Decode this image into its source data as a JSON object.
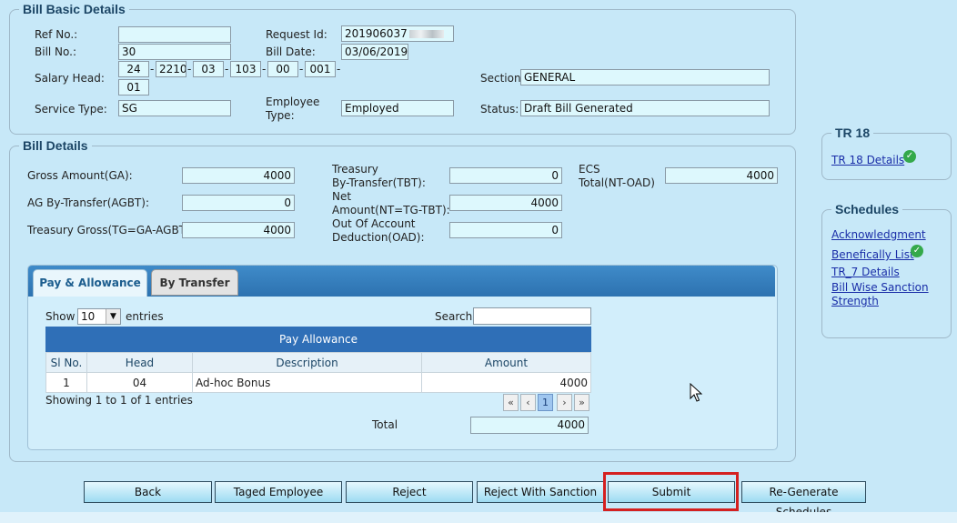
{
  "bill_basic": {
    "legend": "Bill Basic Details",
    "ref_label": "Ref No.:",
    "ref_value": "",
    "request_id_label": "Request Id:",
    "request_id_value": "201906037",
    "bill_no_label": "Bill No.:",
    "bill_no_value": "30",
    "bill_date_label": "Bill Date:",
    "bill_date_value": "03/06/2019",
    "salary_head_label": "Salary Head:",
    "salary_head_parts": [
      "24",
      "2210",
      "03",
      "103",
      "00",
      "001",
      "01"
    ],
    "section_label": "Section:",
    "section_value": "GENERAL",
    "service_type_label": "Service Type:",
    "service_type_value": "SG",
    "employee_type_label_1": "Employee",
    "employee_type_label_2": "Type:",
    "employee_type_value": "Employed",
    "status_label": "Status:",
    "status_value": "Draft Bill Generated"
  },
  "bill_details": {
    "legend": "Bill Details",
    "ga_label": "Gross Amount(GA):",
    "ga_value": "4000",
    "agbt_label": "AG By-Transfer(AGBT):",
    "agbt_value": "0",
    "tg_label": "Treasury Gross(TG=GA-AGBT):",
    "tg_value": "4000",
    "tbt_label_1": "Treasury",
    "tbt_label_2": "By-Transfer(TBT):",
    "tbt_value": "0",
    "nt_label_1": "Net",
    "nt_label_2": "Amount(NT=TG-TBT):",
    "nt_value": "4000",
    "oad_label_1": "Out Of Account",
    "oad_label_2": "Deduction(OAD):",
    "oad_value": "0",
    "ecs_label_1": "ECS",
    "ecs_label_2": "Total(NT-OAD)",
    "ecs_value": "4000"
  },
  "tabs": {
    "pay_allowance": "Pay & Allowance",
    "by_transfer": "By Transfer"
  },
  "table": {
    "show_label": "Show",
    "show_value": "10",
    "entries_label": "entries",
    "search_label": "Search",
    "search_value": "",
    "caption": "Pay Allowance",
    "columns": [
      "Sl No.",
      "Head",
      "Description",
      "Amount"
    ],
    "rows": [
      {
        "sl": "1",
        "head": "04",
        "description": "Ad-hoc Bonus",
        "amount": "4000"
      }
    ],
    "showing_text": "Showing 1 to 1 of 1 entries",
    "pager": {
      "first": "«",
      "prev": "‹",
      "page": "1",
      "next": "›",
      "last": "»"
    },
    "total_label": "Total",
    "total_value": "4000"
  },
  "tr18": {
    "legend": "TR 18",
    "link": "TR 18 Details"
  },
  "schedules": {
    "legend": "Schedules",
    "acknowledgment": "Acknowledgment",
    "beneficiary": "Benefically List",
    "tr7": "TR_7 Details",
    "sanction_1": "Bill Wise Sanction",
    "sanction_2": "Strength"
  },
  "buttons": {
    "back": "Back",
    "taged": "Taged Employee",
    "reject": "Reject",
    "reject_sanction": "Reject With Sanction",
    "submit": "Submit",
    "regenerate": "Re-Generate Schedules"
  },
  "colors": {
    "legend": "#1c4666",
    "highlight": "#d42020",
    "active_tab": "#1c5d8e",
    "header": "#2f6fb7"
  }
}
